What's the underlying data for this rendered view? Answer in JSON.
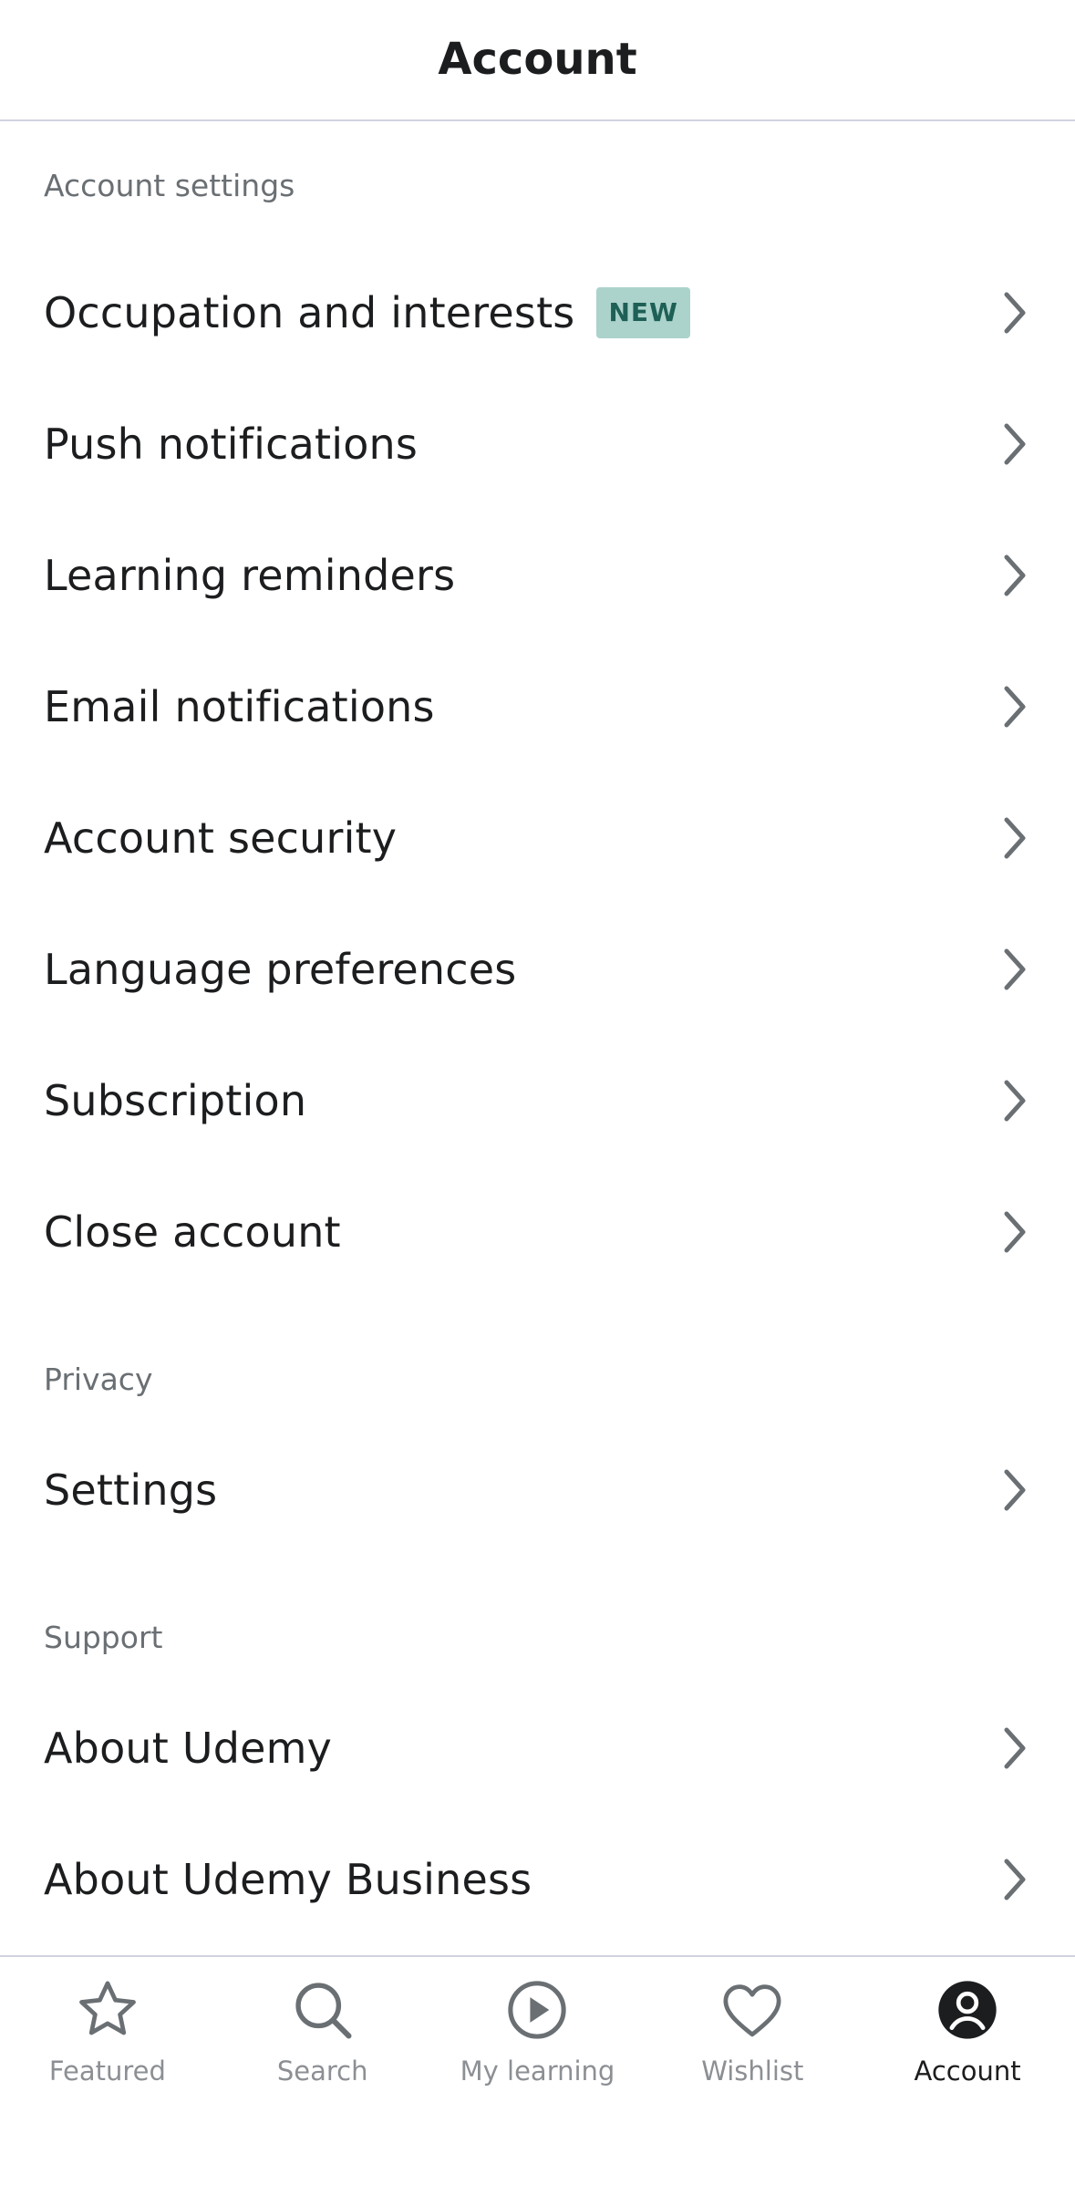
{
  "header": {
    "title": "Account"
  },
  "sections": {
    "account_settings": {
      "label": "Account settings",
      "items": [
        {
          "label": "Occupation and interests",
          "badge": "NEW"
        },
        {
          "label": "Push notifications"
        },
        {
          "label": "Learning reminders"
        },
        {
          "label": "Email notifications"
        },
        {
          "label": "Account security"
        },
        {
          "label": "Language preferences"
        },
        {
          "label": "Subscription"
        },
        {
          "label": "Close account"
        }
      ]
    },
    "privacy": {
      "label": "Privacy",
      "items": [
        {
          "label": "Settings"
        }
      ]
    },
    "support": {
      "label": "Support",
      "items": [
        {
          "label": "About Udemy"
        },
        {
          "label": "About Udemy Business"
        }
      ]
    }
  },
  "tabbar": {
    "tabs": [
      {
        "label": "Featured",
        "icon": "star-icon"
      },
      {
        "label": "Search",
        "icon": "search-icon"
      },
      {
        "label": "My learning",
        "icon": "play-circle-icon"
      },
      {
        "label": "Wishlist",
        "icon": "heart-icon"
      },
      {
        "label": "Account",
        "icon": "account-icon",
        "active": true
      }
    ]
  },
  "colors": {
    "text": "#1c1d1f",
    "muted": "#6a6f73",
    "badge_bg": "#acd2cc",
    "badge_text": "#1e6055",
    "divider": "#d1d2e0"
  }
}
